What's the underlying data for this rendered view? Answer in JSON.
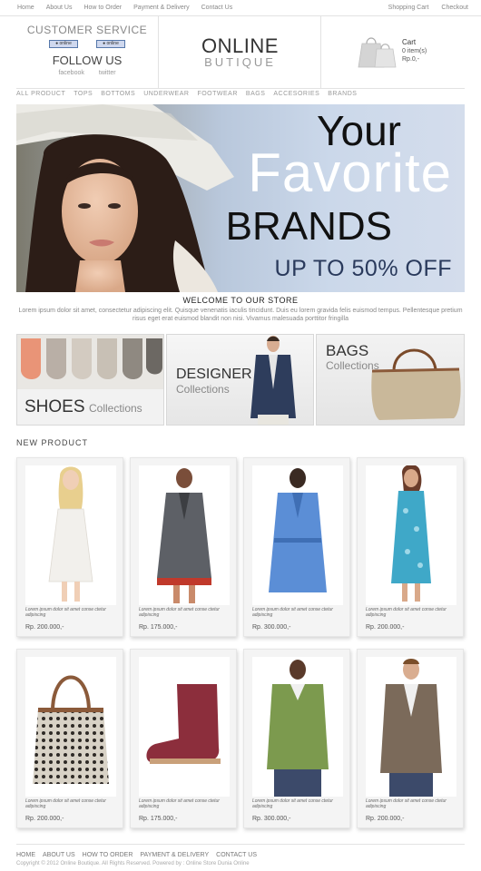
{
  "top_nav": {
    "left": [
      "Home",
      "About Us",
      "How to Order",
      "Payment & Delivery",
      "Contact Us"
    ],
    "right": [
      "Shopping Cart",
      "Checkout"
    ]
  },
  "header": {
    "customer_service": "CUSTOMER SERVICE",
    "messenger_buttons": [
      "● online",
      "● online"
    ],
    "follow_us": "FOLLOW US",
    "social": [
      "facebook",
      "twitter"
    ],
    "logo_line1": "ONLINE",
    "logo_line2": "BUTIQUE",
    "cart_title": "Cart",
    "cart_items": "0 item(s)",
    "cart_total": "Rp.0,-"
  },
  "category_nav": [
    "ALL PRODUCT",
    "TOPS",
    "BOTTOMS",
    "UNDERWEAR",
    "FOOTWEAR",
    "BAGS",
    "ACCESORIES",
    "BRANDS"
  ],
  "banner": {
    "line1": "Your",
    "line2": "Favorite",
    "line3": "BRANDS",
    "line4": "UP TO 50% OFF"
  },
  "welcome": {
    "title": "WELCOME TO OUR STORE",
    "text": "Lorem ipsum dolor sit amet, consectetur adipiscing elit. Quisque venenatis iaculis tincidunt. Duis eu lorem gravida felis euismod tempus. Pellentesque pretium risus eget erat euismod blandit non nisi. Vivamus malesuada porttitor fringilla"
  },
  "collections": {
    "shoes": {
      "big": "SHOES",
      "small": "Collections"
    },
    "designer": {
      "big": "DESIGNER",
      "small": "Collections"
    },
    "bags": {
      "big": "BAGS",
      "small": "Collections"
    }
  },
  "new_product_title": "NEW PRODUCT",
  "products": [
    {
      "desc": "Lorem ipsum dolor sit amet conse ctetur adipiscing",
      "price": "Rp. 200.000,-"
    },
    {
      "desc": "Lorem ipsum dolor sit amet conse ctetur adipiscing",
      "price": "Rp. 175.000,-"
    },
    {
      "desc": "Lorem ipsum dolor sit amet conse ctetur adipiscing",
      "price": "Rp. 300.000,-"
    },
    {
      "desc": "Lorem ipsum dolor sit amet conse ctetur adipiscing",
      "price": "Rp. 200.000,-"
    },
    {
      "desc": "Lorem ipsum dolor sit amet conse ctetur adipiscing",
      "price": "Rp. 200.000,-"
    },
    {
      "desc": "Lorem ipsum dolor sit amet conse ctetur adipiscing",
      "price": "Rp. 175.000,-"
    },
    {
      "desc": "Lorem ipsum dolor sit amet conse ctetur adipiscing",
      "price": "Rp. 300.000,-"
    },
    {
      "desc": "Lorem ipsum dolor sit amet conse ctetur adipiscing",
      "price": "Rp. 200.000,-"
    }
  ],
  "footer": {
    "nav": [
      "HOME",
      "ABOUT US",
      "HOW TO ORDER",
      "PAYMENT & DELIVERY",
      "CONTACT US"
    ],
    "copyright": "Copyright © 2012 Online Boutique. All Rights Reserved. Powered by : Online Store Dunia Online"
  }
}
